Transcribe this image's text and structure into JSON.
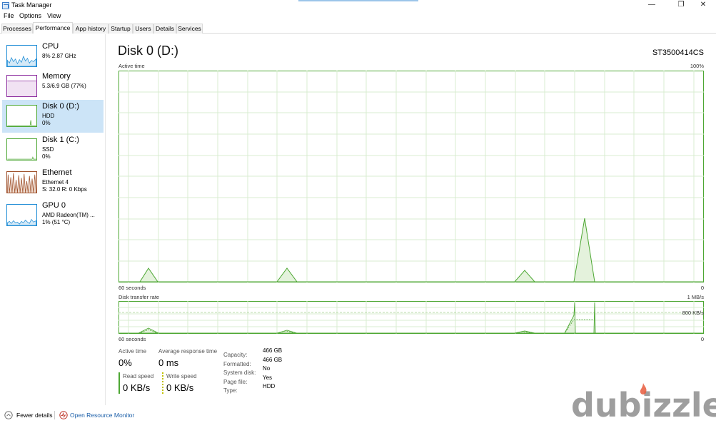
{
  "window": {
    "title": "Task Manager",
    "accent": "#3a7bc8"
  },
  "menu": [
    "File",
    "Options",
    "View"
  ],
  "tabs": [
    {
      "label": "Processes"
    },
    {
      "label": "Performance",
      "active": true
    },
    {
      "label": "App history"
    },
    {
      "label": "Startup"
    },
    {
      "label": "Users"
    },
    {
      "label": "Details"
    },
    {
      "label": "Services"
    }
  ],
  "sidebar": {
    "items": [
      {
        "title": "CPU",
        "sub1": "8% 2.87 GHz",
        "sub2": "",
        "color": "#1f8dd6",
        "icon": "cpu-graph"
      },
      {
        "title": "Memory",
        "sub1": "5.3/6.9 GB (77%)",
        "sub2": "",
        "color": "#8b2a9d",
        "icon": "memory-graph"
      },
      {
        "title": "Disk 0 (D:)",
        "sub1": "HDD",
        "sub2": "0%",
        "color": "#4da733",
        "icon": "disk-graph",
        "selected": true
      },
      {
        "title": "Disk 1 (C:)",
        "sub1": "SSD",
        "sub2": "0%",
        "color": "#4da733",
        "icon": "disk-graph"
      },
      {
        "title": "Ethernet",
        "sub1": "Ethernet 4",
        "sub2": "S: 32.0 R: 0 Kbps",
        "color": "#a0522d",
        "icon": "ethernet-graph"
      },
      {
        "title": "GPU 0",
        "sub1": "AMD Radeon(TM) ...",
        "sub2": "1% (51 °C)",
        "color": "#1f8dd6",
        "icon": "gpu-graph"
      }
    ]
  },
  "main": {
    "title": "Disk 0 (D:)",
    "model": "ST3500414CS",
    "chart1": {
      "label": "Active time",
      "max_label": "100%",
      "left_bottom": "60 seconds",
      "right_bottom": "0"
    },
    "chart2": {
      "label": "Disk transfer rate",
      "max_label": "1 MB/s",
      "mid_label": "800 KB/s",
      "left_bottom": "60 seconds",
      "right_bottom": "0"
    },
    "stats": {
      "active_time_label": "Active time",
      "active_time_value": "0%",
      "avg_resp_label": "Average response time",
      "avg_resp_value": "0 ms",
      "read_label": "Read speed",
      "read_value": "0 KB/s",
      "write_label": "Write speed",
      "write_value": "0 KB/s"
    },
    "properties": [
      {
        "label": "Capacity:",
        "value": "466 GB"
      },
      {
        "label": "Formatted:",
        "value": "466 GB"
      },
      {
        "label": "System disk:",
        "value": "No"
      },
      {
        "label": "Page file:",
        "value": "Yes"
      },
      {
        "label": "Type:",
        "value": "HDD"
      }
    ]
  },
  "footer": {
    "fewer_details": "Fewer details",
    "open_resource_monitor": "Open Resource Monitor"
  },
  "watermark": "dubizzle",
  "colors": {
    "disk_green": "#4da733",
    "grid": "#d8ecd0",
    "selected_bg": "#cce4f7",
    "link": "#1a5ea8"
  }
}
